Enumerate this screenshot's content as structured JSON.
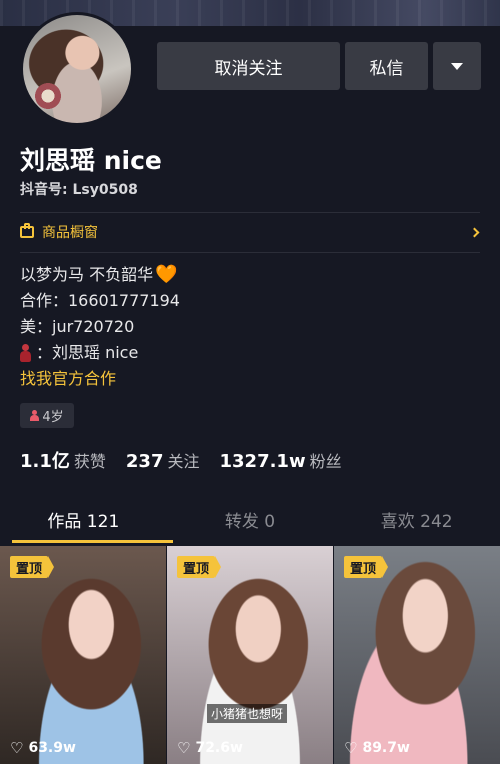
{
  "profile": {
    "name": "刘思瑶 nice",
    "douyin_id": "抖音号: Lsy0508",
    "age_tag": "4岁"
  },
  "actions": {
    "unfollow_label": "取消关注",
    "message_label": "私信",
    "more_icon": "caret-down-icon"
  },
  "shop": {
    "label": "商品橱窗",
    "icon": "shop-icon"
  },
  "bio": {
    "line1": "以梦为马 不负韶华",
    "line1_emoji": "🧡",
    "line2": "合作：16601777194",
    "line3": " 美：jur720720",
    "line4": "：刘思瑶 nice",
    "line5": "找我官方合作"
  },
  "stats": [
    {
      "num": "1.1亿",
      "label": "获赞"
    },
    {
      "num": "237",
      "label": "关注"
    },
    {
      "num": "1327.1w",
      "label": "粉丝"
    }
  ],
  "tabs": [
    {
      "label": "作品 121",
      "active": true
    },
    {
      "label": "转发 0",
      "active": false
    },
    {
      "label": "喜欢 242",
      "active": false
    }
  ],
  "videos": [
    {
      "badge": "置顶",
      "likes": "63.9w",
      "caption": ""
    },
    {
      "badge": "置顶",
      "likes": "72.6w",
      "caption": "小猪猪也想呀"
    },
    {
      "badge": "置顶",
      "likes": "89.7w",
      "caption": ""
    }
  ],
  "colors": {
    "background": "#161823",
    "accent": "#f5c33b",
    "button": "#393b44"
  }
}
